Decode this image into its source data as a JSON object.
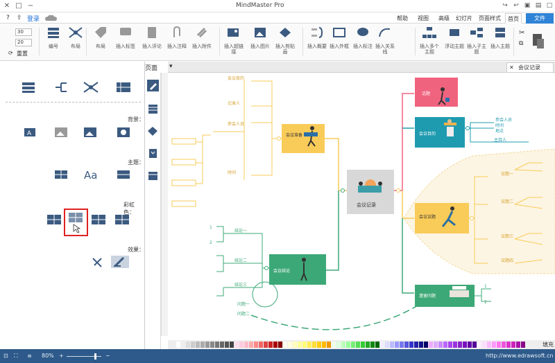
{
  "window": {
    "title": "MindMaster Pro",
    "login_label": "登录",
    "buttons": [
      "✕",
      "□",
      "−"
    ]
  },
  "menu": {
    "file": "文件",
    "tabs": [
      "首页",
      "页面样式",
      "幻灯片",
      "高级",
      "视图",
      "帮助"
    ]
  },
  "ribbon": {
    "groups": [
      {
        "label": "插入主题"
      },
      {
        "label": "插入子主题"
      },
      {
        "label": "浮动主题"
      },
      {
        "label": "插入多个主题"
      },
      {
        "label": "插入关系线"
      },
      {
        "label": "插入标注"
      },
      {
        "label": "插入外框"
      },
      {
        "label": "插入概要"
      },
      {
        "label": "插入剪贴画"
      },
      {
        "label": "插入图片"
      },
      {
        "label": "插入超链接"
      },
      {
        "label": "插入附件"
      },
      {
        "label": "插入注释"
      },
      {
        "label": "插入评论"
      },
      {
        "label": "插入标签"
      },
      {
        "label": "布局"
      },
      {
        "label": "编号"
      }
    ],
    "spin1": "30",
    "spin2": "20",
    "reset_label": "重置"
  },
  "left_panel": {
    "title": "页面",
    "background_label": "背景：",
    "theme_label": "主题：",
    "rainbow_label": "彩虹色：",
    "effect_label": "效果："
  },
  "document": {
    "tab_label": "会议记录"
  },
  "mindmap": {
    "central": "会议记录",
    "topics": [
      "话题",
      "会议目的",
      "会议议题",
      "遗留问题",
      "会议结论",
      "会议准备"
    ],
    "sub_items": [
      "参会人员",
      "时间",
      "地点",
      "主持人",
      "记录人",
      "会议目的",
      "议题一",
      "议题二",
      "议题三",
      "议题四",
      "结论一",
      "结论二",
      "结论三",
      "问题一",
      "问题二",
      "问题三",
      "1",
      "2"
    ]
  },
  "status": {
    "url": "http://www.edrawsoft.cn",
    "zoom": "80%",
    "fill_label": "填充"
  },
  "colors": {
    "accent": "#2f83d6",
    "status_bar": "#2d5a8a",
    "topic_pink": "#f0637f",
    "topic_teal": "#1f9bb0",
    "topic_yellow": "#f9cb58",
    "topic_green": "#3da877",
    "central_gray": "#d8d8d8",
    "highlight_red": "#e02020"
  }
}
